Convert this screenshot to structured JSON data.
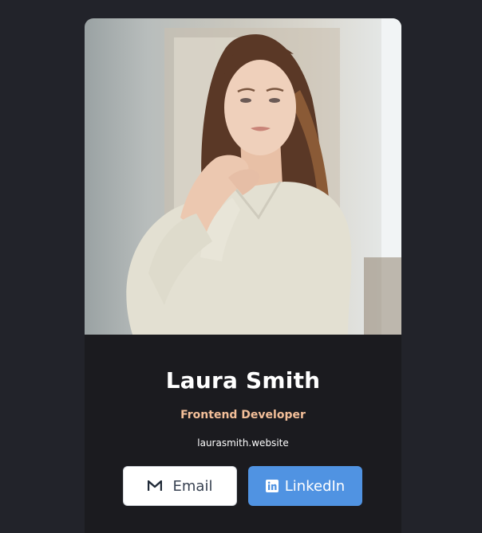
{
  "profile": {
    "name": "Laura Smith",
    "role": "Frontend Developer",
    "website": "laurasmith.website"
  },
  "buttons": {
    "email": {
      "label": "Email",
      "icon": "gmail-icon"
    },
    "linkedin": {
      "label": "LinkedIn",
      "icon": "linkedin-icon"
    }
  },
  "colors": {
    "page_background": "#22232a",
    "card_background": "#1b1b1f",
    "role_accent": "#f3bf99",
    "linkedin_blue": "#5093e2"
  }
}
